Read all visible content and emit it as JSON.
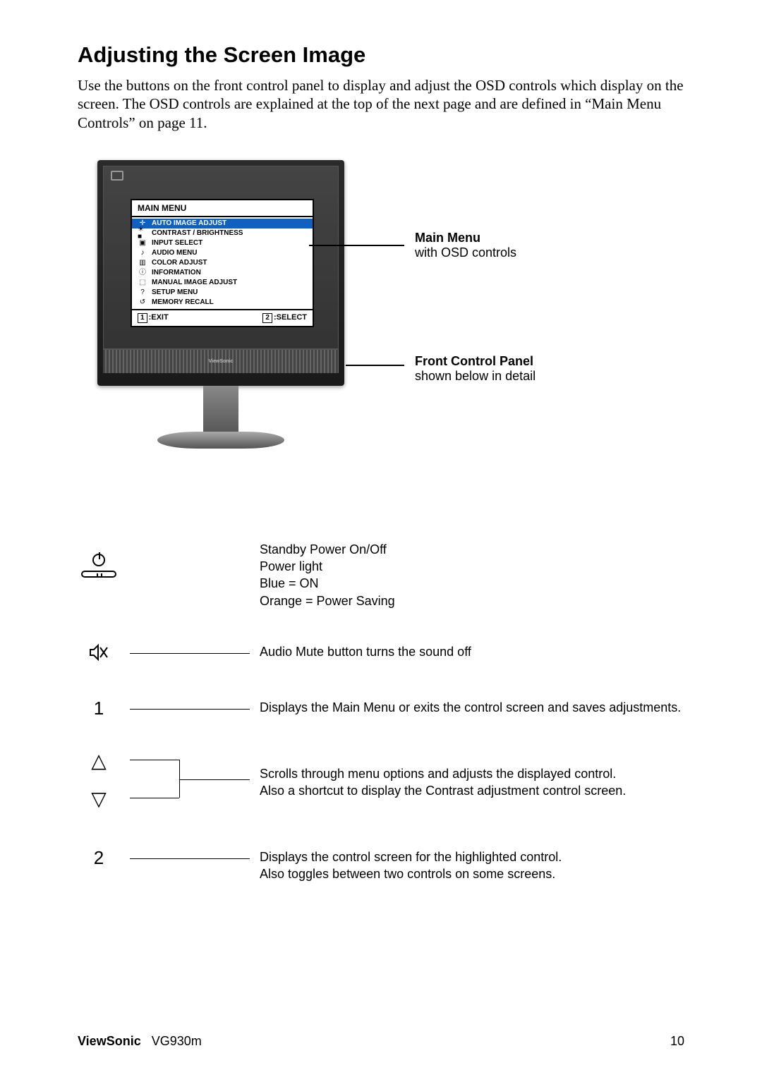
{
  "title": "Adjusting the Screen Image",
  "intro": "Use the buttons on the front control panel to display and adjust the OSD controls which display on the screen. The OSD controls are explained at the top of the next page and are defined in “Main Menu Controls” on page 11.",
  "osd": {
    "title": "MAIN MENU",
    "items": [
      {
        "icon": "✛",
        "label": "AUTO IMAGE ADJUST",
        "highlight": true
      },
      {
        "icon": "☀■",
        "label": "CONTRAST / BRIGHTNESS",
        "highlight": false
      },
      {
        "icon": "▣",
        "label": "INPUT SELECT",
        "highlight": false
      },
      {
        "icon": "♪",
        "label": "AUDIO MENU",
        "highlight": false
      },
      {
        "icon": "▥",
        "label": "COLOR ADJUST",
        "highlight": false
      },
      {
        "icon": "ⓘ",
        "label": "INFORMATION",
        "highlight": false
      },
      {
        "icon": "⬚",
        "label": "MANUAL IMAGE ADJUST",
        "highlight": false
      },
      {
        "icon": "?",
        "label": "SETUP MENU",
        "highlight": false
      },
      {
        "icon": "↺",
        "label": "MEMORY RECALL",
        "highlight": false
      }
    ],
    "footer_exit_num": "1",
    "footer_exit_label": ":EXIT",
    "footer_select_num": "2",
    "footer_select_label": ":SELECT"
  },
  "callouts": {
    "main_menu_bold": "Main Menu",
    "main_menu_text": "with OSD controls",
    "front_panel_bold": "Front Control Panel",
    "front_panel_text": "shown below in detail"
  },
  "brand_on_monitor": "ViewSonic",
  "controls": {
    "power": {
      "line1": "Standby Power On/Off",
      "line2": "Power light",
      "line3": "Blue = ON",
      "line4": "Orange = Power Saving"
    },
    "mute": "Audio Mute button turns the sound off",
    "btn1": "Displays the Main Menu or exits the control screen and saves adjustments.",
    "arrows": {
      "line1": "Scrolls through menu options and adjusts the displayed control.",
      "line2": "Also a shortcut to display the Contrast adjustment control screen."
    },
    "btn2": {
      "line1": "Displays the control screen for the highlighted control.",
      "line2": "Also toggles between two controls on some screens."
    },
    "label_1": "1",
    "label_2": "2"
  },
  "footer": {
    "brand": "ViewSonic",
    "model": "VG930m",
    "page": "10"
  }
}
